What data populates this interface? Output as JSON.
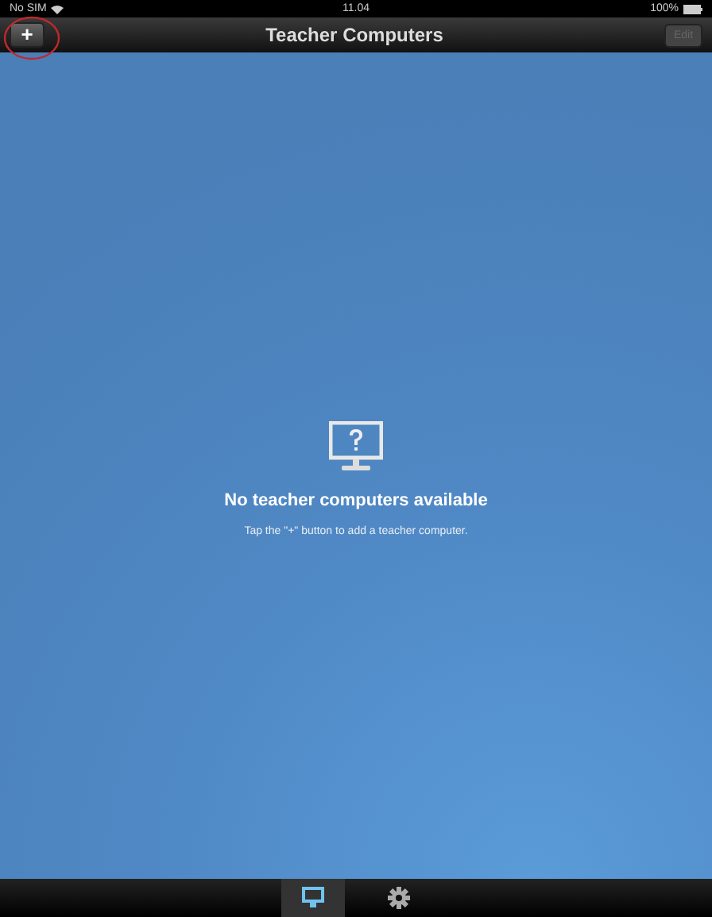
{
  "status_bar": {
    "carrier": "No SIM",
    "time": "11.04",
    "battery": "100%"
  },
  "nav_bar": {
    "title": "Teacher Computers",
    "add_button": "+",
    "edit_button": {
      "label": "Edit",
      "disabled": true
    }
  },
  "empty_state": {
    "title": "No teacher computers available",
    "message": "Tap the \"+\" button to add a teacher computer."
  },
  "tab_bar": {
    "tabs": [
      {
        "kind": "monitor",
        "selected": true
      },
      {
        "kind": "gear",
        "selected": false
      }
    ]
  }
}
